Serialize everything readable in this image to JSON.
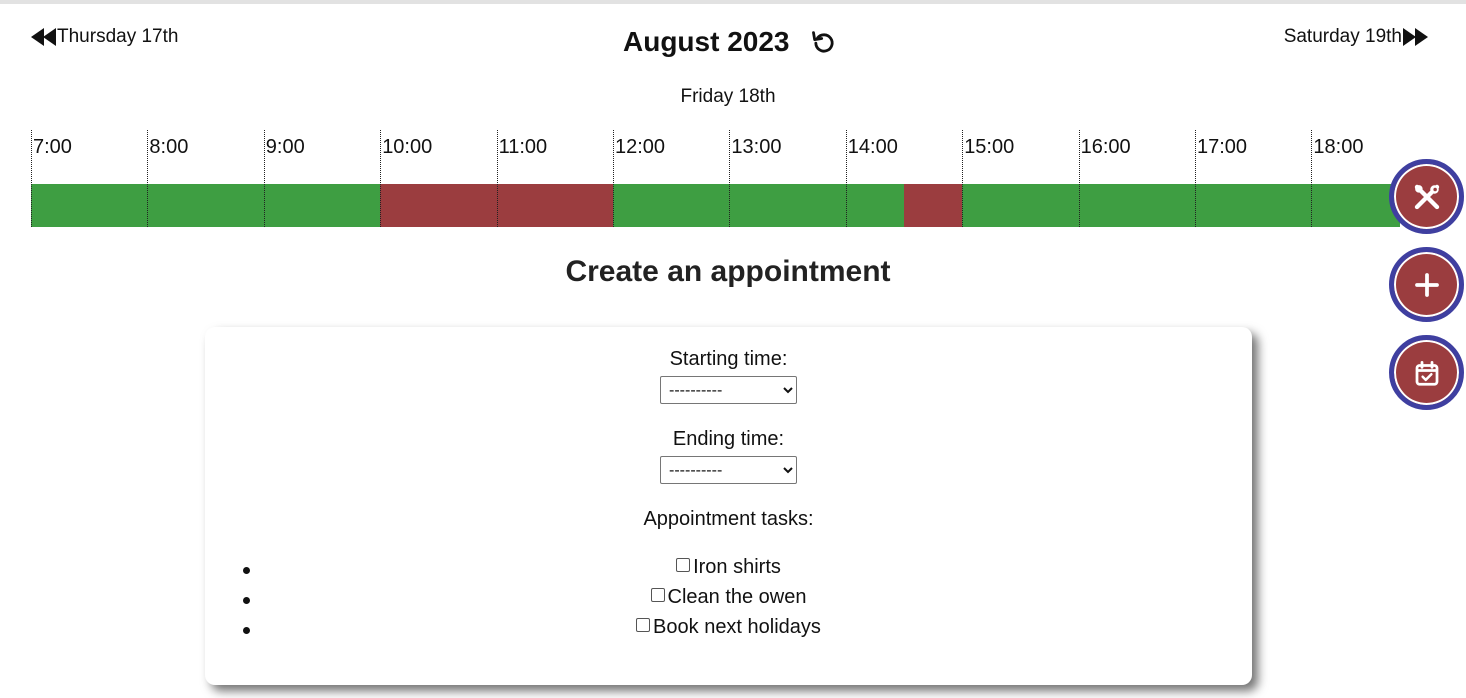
{
  "nav": {
    "prev_label": "Thursday 17th",
    "next_label": "Saturday 19th",
    "month_label": "August 2023",
    "icons": {
      "prev": "double-left-arrow-icon",
      "next": "double-right-arrow-icon",
      "reset": "reset-icon"
    }
  },
  "day_label": "Friday 18th",
  "timeline": {
    "hours": [
      "7:00",
      "8:00",
      "9:00",
      "10:00",
      "11:00",
      "12:00",
      "13:00",
      "14:00",
      "15:00",
      "16:00",
      "17:00",
      "18:00"
    ],
    "colors": {
      "free": "#3e9e42",
      "busy": "#9b3d3f"
    },
    "busy_periods": [
      {
        "start": "10:00",
        "end": "12:00"
      },
      {
        "start": "14:30",
        "end": "15:00"
      }
    ]
  },
  "fabs": [
    {
      "name": "tools-button",
      "icon": "tools-icon"
    },
    {
      "name": "add-button",
      "icon": "plus-icon"
    },
    {
      "name": "calendar-button",
      "icon": "calendar-check-icon"
    }
  ],
  "form": {
    "title": "Create an appointment",
    "starting_time_label": "Starting time:",
    "starting_time_value": "----------",
    "ending_time_label": "Ending time:",
    "ending_time_value": "----------",
    "tasks_label": "Appointment tasks:",
    "tasks": [
      {
        "label": "Iron shirts",
        "checked": false
      },
      {
        "label": "Clean the owen",
        "checked": false
      },
      {
        "label": "Book next holidays",
        "checked": false
      }
    ]
  },
  "colors": {
    "accent": "#9b3d3f",
    "fab_ring": "#3f3fa0",
    "free": "#3e9e42"
  }
}
